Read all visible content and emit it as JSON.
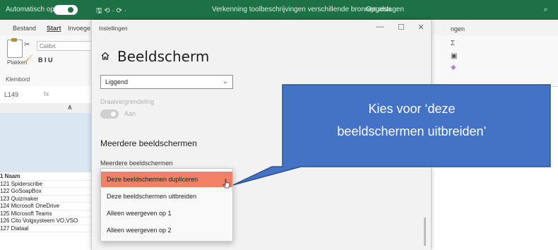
{
  "excel": {
    "title_left": "Automatisch opslaan",
    "title_center": "Verkenning toolbeschrijvingen verschillende bronnen.xlsx",
    "title_saved": "Opgeslagen",
    "tabs": [
      "Bestand",
      "Start",
      "Invoege"
    ],
    "right_tab": "ngen",
    "paste_label": "Plakken",
    "clipboard_label": "Klembord",
    "font_name": "Calibri",
    "font_style": "B  I  U",
    "cell_ref": "L149",
    "col_a": "A",
    "row_header": "1   Naam",
    "rows": [
      "121 Spiderscribe",
      "122 GoSoapBox",
      "123 Quizmaker",
      "124 Microsoft OneDrive",
      "125 Microsoft Teams",
      "126 Cito Volgsysteem VO,VSO",
      "127 Diataal"
    ]
  },
  "settings": {
    "window_title": "Instellingen",
    "min": "—",
    "max": "☐",
    "close": "✕",
    "page_title": "Beeldscherm",
    "orientation_value": "Liggend",
    "rotation_lock_label": "Draaivergrendeling",
    "rotation_lock_state": "Aan",
    "multi_heading": "Meerdere beeldschermen",
    "multi_label": "Meerdere beeldschermen",
    "options": [
      "Deze beeldschermen dupliceren",
      "Deze beeldschermen uitbreiden",
      "Alleen weergeven op 1",
      "Alleen weergeven op 2"
    ],
    "selected_index": 0
  },
  "callout": {
    "line1": "Kies voor ‘deze",
    "line2": "beeldschermen uitbreiden’",
    "fill": "#4472c4",
    "stroke": "#2f528f"
  }
}
